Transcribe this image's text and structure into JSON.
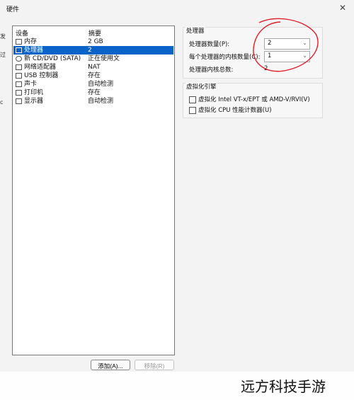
{
  "dialog": {
    "title": "硬件",
    "close_icon": "x-close-icon"
  },
  "background_fragments": [
    "发",
    "过",
    "c"
  ],
  "devices": {
    "columns": [
      "设备",
      "摘要"
    ],
    "items": [
      {
        "icon": "memory-icon",
        "name": "内存",
        "summary": "2 GB"
      },
      {
        "icon": "processor-icon",
        "name": "处理器",
        "summary": "2",
        "selected": true
      },
      {
        "icon": "cd-icon",
        "name": "新 CD/DVD (SATA)",
        "summary": "正在使用文"
      },
      {
        "icon": "network-icon",
        "name": "网络适配器",
        "summary": "NAT"
      },
      {
        "icon": "usb-icon",
        "name": "USB 控制器",
        "summary": "存在"
      },
      {
        "icon": "sound-icon",
        "name": "声卡",
        "summary": "自动检测"
      },
      {
        "icon": "printer-icon",
        "name": "打印机",
        "summary": "存在"
      },
      {
        "icon": "display-icon",
        "name": "显示器",
        "summary": "自动检测"
      }
    ],
    "buttons": {
      "add": "添加(A)...",
      "remove": "移除(R)"
    }
  },
  "processor": {
    "group": "处理器",
    "processor_count_label": "处理器数量(P):",
    "processor_count_value": "2",
    "cores_label": "每个处理器的内核数量(C):",
    "cores_value": "1",
    "total_label": "处理器内核总数:",
    "total_value": "2"
  },
  "virtualization": {
    "group": "虚拟化引擎",
    "option1": "虚拟化 Intel VT-x/EPT 或 AMD-V/RVI(V)",
    "option2": "虚拟化 CPU 性能计数器(U)"
  },
  "colors": {
    "selected": "#0a63c9",
    "annotation": "#e11f2c"
  },
  "watermark": "远方科技手游"
}
